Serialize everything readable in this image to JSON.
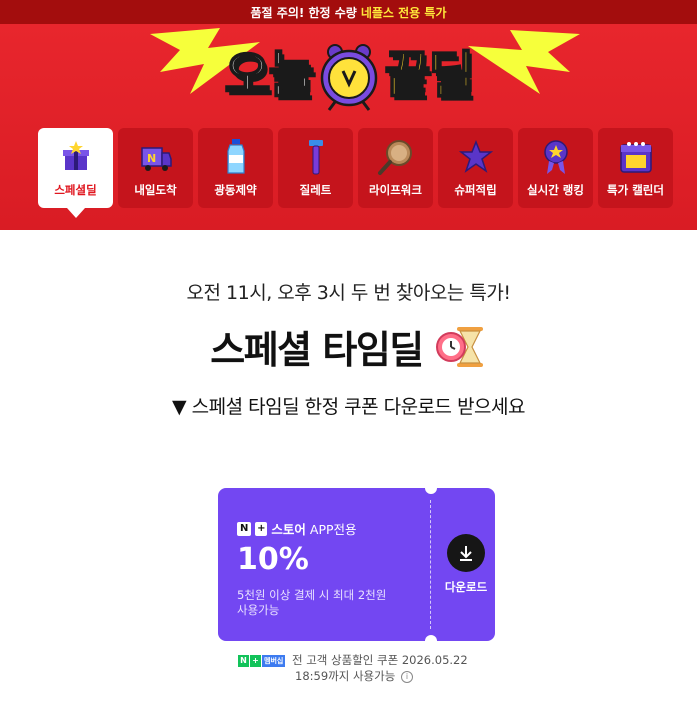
{
  "topbar": {
    "prefix": "품절 주의! 한정 수량",
    "highlight": "네플스 전용 특가"
  },
  "hero": {
    "logo_left": "오늘",
    "logo_right": "끝딜",
    "categories": [
      {
        "label": "스페셜딜",
        "icon": "gift-box-icon"
      },
      {
        "label": "내일도착",
        "icon": "delivery-truck-icon"
      },
      {
        "label": "광동제약",
        "icon": "water-bottle-icon"
      },
      {
        "label": "질레트",
        "icon": "razor-icon"
      },
      {
        "label": "라이프워크",
        "icon": "frying-pan-icon"
      },
      {
        "label": "슈퍼적립",
        "icon": "star-icon"
      },
      {
        "label": "실시간 랭킹",
        "icon": "medal-icon"
      },
      {
        "label": "특가 캘린더",
        "icon": "calendar-icon"
      }
    ],
    "active_index": 0
  },
  "main": {
    "subtitle": "오전 11시, 오후 3시 두 번 찾아오는 특가!",
    "title": "스페셜 타임딜",
    "notice": "▼ 스페셜 타임딜 한정 쿠폰 다운로드 받으세요"
  },
  "coupon": {
    "badge_n": "N",
    "badge_plus": "+",
    "store": "스토어",
    "app_only": "APP전용",
    "discount": "10%",
    "condition_line1": "5천원 이상 결제 시 최대 2천원",
    "condition_line2": "사용가능",
    "download_label": "다운로드",
    "bg_color": "#7347f2"
  },
  "footnote": {
    "badge_text": "멤버십",
    "line1": "전 고객 상품할인 쿠폰 2026.05.22",
    "line2": "18:59까지 사용가능"
  }
}
